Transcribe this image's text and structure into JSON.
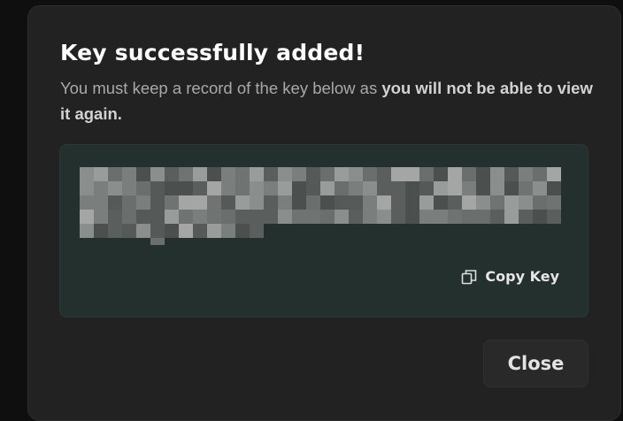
{
  "dialog": {
    "title": "Key successfully added!",
    "description_prefix": "You must keep a record of the key below as ",
    "description_bold": "you will not be able to view it again.",
    "key": {
      "masked": true,
      "copy_label": "Copy Key",
      "copy_icon": "copy-icon"
    },
    "close_label": "Close"
  },
  "colors": {
    "dialog_background": "#222222",
    "key_box_background": "#23302d",
    "title": "#ffffff",
    "description": "#a9a9a9"
  }
}
